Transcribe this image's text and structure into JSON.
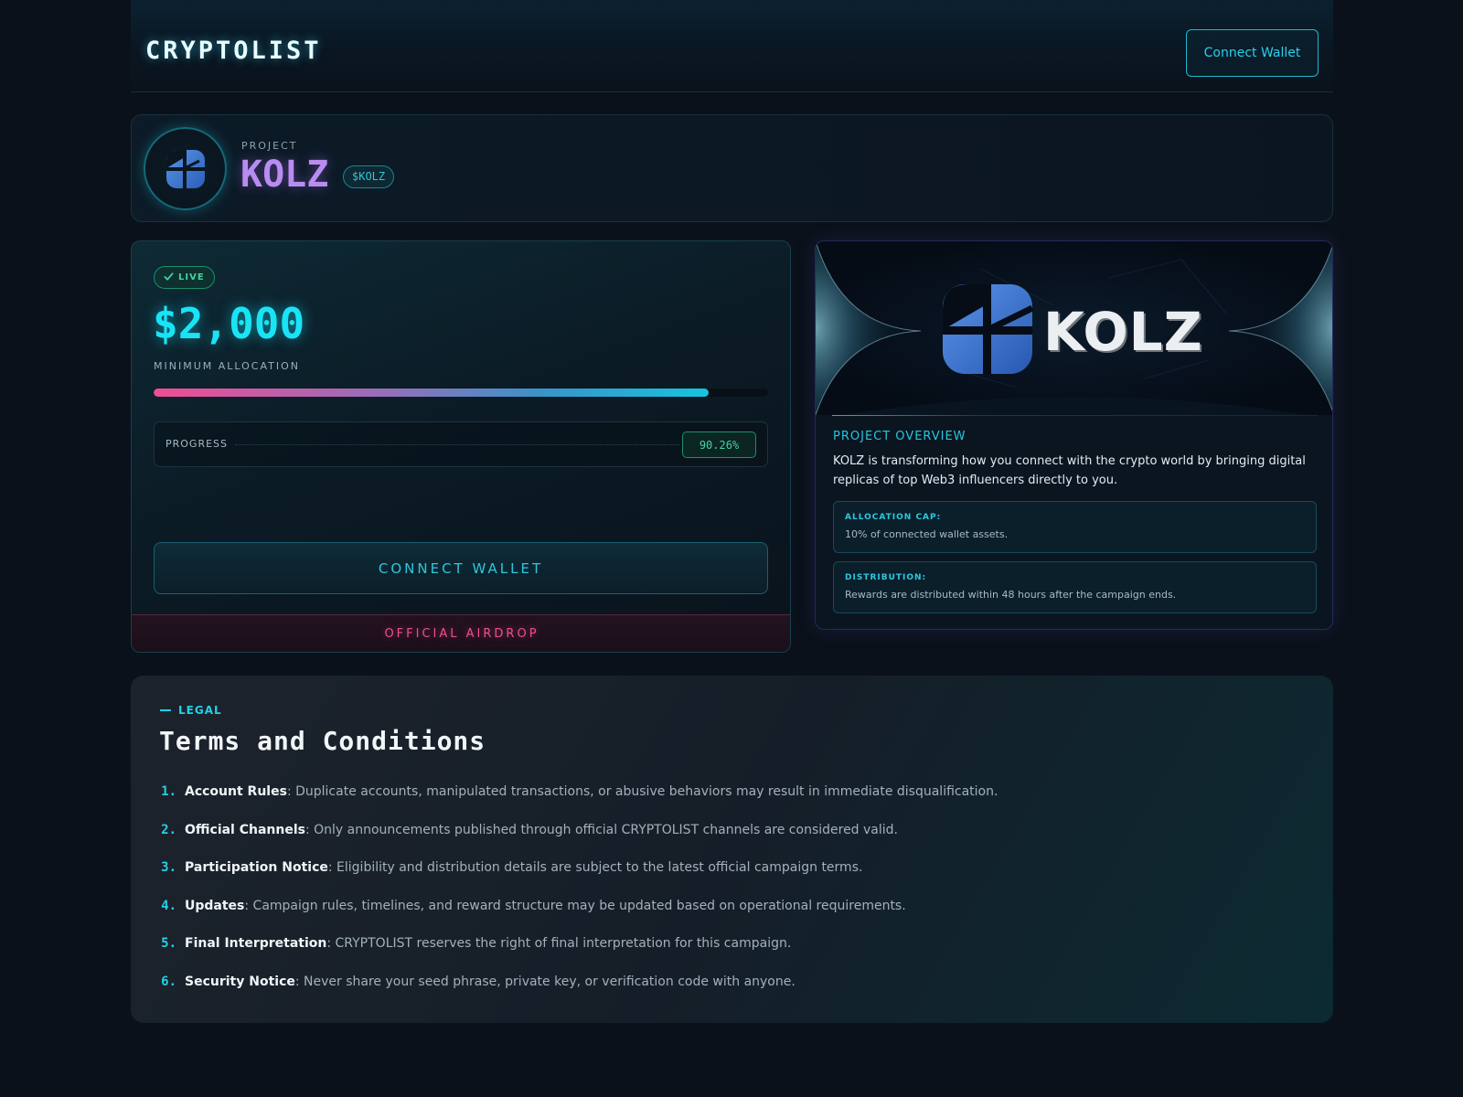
{
  "header": {
    "logo": "CRYPTOLIST",
    "connect_label": "Connect Wallet"
  },
  "project": {
    "kicker": "PROJECT",
    "name": "KOLZ",
    "ticker": "$KOLZ"
  },
  "allocation": {
    "status": "LIVE",
    "amount": "$2,000",
    "amount_label": "MINIMUM ALLOCATION",
    "progress_fraction": 0.9026,
    "progress_label": "PROGRESS",
    "progress_text": "90.26%",
    "connect_label": "CONNECT WALLET",
    "footer_label": "OFFICIAL AIRDROP"
  },
  "overview": {
    "banner_logo": "KOLZ",
    "title": "PROJECT OVERVIEW",
    "description": "KOLZ is transforming how you connect with the crypto world by bringing digital replicas of top Web3 influencers directly to you.",
    "cap_key": "ALLOCATION CAP:",
    "cap_value": "10% of connected wallet assets.",
    "dist_key": "DISTRIBUTION:",
    "dist_value": "Rewards are distributed within 48 hours after the campaign ends."
  },
  "terms": {
    "kicker": "LEGAL",
    "title": "Terms and Conditions",
    "items": [
      {
        "num": "1.",
        "name": "Account Rules",
        "text": ": Duplicate accounts, manipulated transactions, or abusive behaviors may result in immediate disqualification."
      },
      {
        "num": "2.",
        "name": "Official Channels",
        "text": ": Only announcements published through official CRYPTOLIST channels are considered valid."
      },
      {
        "num": "3.",
        "name": "Participation Notice",
        "text": ": Eligibility and distribution details are subject to the latest official campaign terms."
      },
      {
        "num": "4.",
        "name": "Updates",
        "text": ": Campaign rules, timelines, and reward structure may be updated based on operational requirements."
      },
      {
        "num": "5.",
        "name": "Final Interpretation",
        "text": ": CRYPTOLIST reserves the right of final interpretation for this campaign."
      },
      {
        "num": "6.",
        "name": "Security Notice",
        "text": ": Never share your seed phrase, private key, or verification code with anyone."
      }
    ]
  },
  "colors": {
    "accent_cyan": "#19e4f5",
    "accent_purple": "#b88cf0",
    "accent_pink": "#ef4e92",
    "accent_green": "#3fd49e",
    "background": "#0a111a"
  },
  "icons": {
    "project_logo": "kolz-logo-icon",
    "live": "check-icon"
  }
}
